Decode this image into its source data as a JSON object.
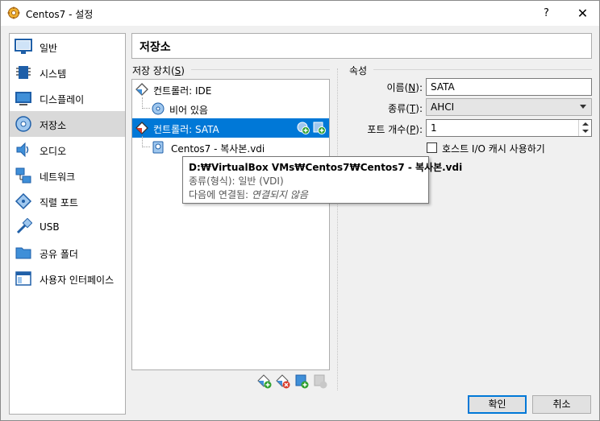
{
  "window": {
    "title": "Centos7 - 설정",
    "help_label": "?",
    "close_label": "✕"
  },
  "sidebar": {
    "items": [
      {
        "label": "일반",
        "icon": "monitor-icon"
      },
      {
        "label": "시스템",
        "icon": "chip-icon"
      },
      {
        "label": "디스플레이",
        "icon": "display-icon"
      },
      {
        "label": "저장소",
        "icon": "disk-icon",
        "selected": true
      },
      {
        "label": "오디오",
        "icon": "speaker-icon"
      },
      {
        "label": "네트워크",
        "icon": "network-icon"
      },
      {
        "label": "직렬 포트",
        "icon": "serial-port-icon"
      },
      {
        "label": "USB",
        "icon": "usb-icon"
      },
      {
        "label": "공유 폴더",
        "icon": "folder-icon"
      },
      {
        "label": "사용자 인터페이스",
        "icon": "ui-icon"
      }
    ]
  },
  "page": {
    "title": "저장소"
  },
  "devices": {
    "group_label_prefix": "저장 장치(",
    "group_label_key": "S",
    "group_label_suffix": ")",
    "tree": [
      {
        "label": "컨트롤러: IDE",
        "kind": "controller"
      },
      {
        "label": "비어 있음",
        "kind": "optical"
      },
      {
        "label": "컨트롤러: SATA",
        "kind": "controller",
        "selected": true
      },
      {
        "label": "Centos7 - 복사본.vdi",
        "kind": "hdd"
      }
    ]
  },
  "attributes": {
    "group_label": "속성",
    "name_label_prefix": "이름(",
    "name_label_key": "N",
    "name_label_suffix": "):",
    "name_value": "SATA",
    "type_label_prefix": "종류(",
    "type_label_key": "T",
    "type_label_suffix": "):",
    "type_value": "AHCI",
    "port_label_prefix": "포트 개수(",
    "port_label_key": "P",
    "port_label_suffix": "):",
    "port_value": "1",
    "cache_label": "호스트 I/O 캐시 사용하기",
    "cache_checked": false
  },
  "tooltip": {
    "path": "D:₩VirtualBox VMs₩Centos7₩Centos7 - 복사본.vdi",
    "type_line": "종류(형식):  일반 (VDI)",
    "attached_prefix": "다음에 연결됨: ",
    "attached_value": "연결되지 않음"
  },
  "buttons": {
    "ok": "확인",
    "cancel": "취소"
  },
  "colors": {
    "selection": "#0078d7",
    "sidebar_selected": "#d9d9d9"
  }
}
